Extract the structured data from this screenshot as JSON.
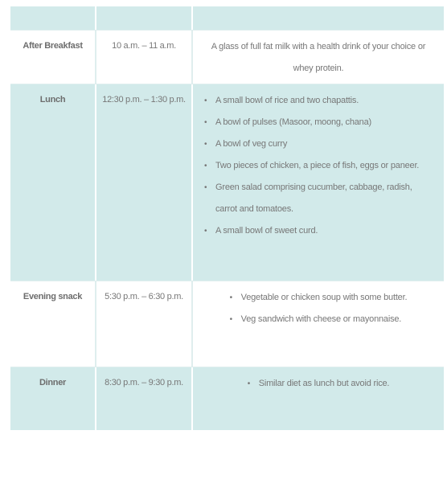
{
  "rows": [
    {
      "meal": "",
      "time": "",
      "items": []
    },
    {
      "meal": "After Breakfast",
      "time": "10 a.m. – 11 a.m.",
      "text": "A glass of full fat milk with a health drink of your choice or whey protein."
    },
    {
      "meal": "Lunch",
      "time": "12:30 p.m. – 1:30 p.m.",
      "items": [
        "A small bowl of rice and two chapattis.",
        "A bowl of pulses (Masoor, moong, chana)",
        "A bowl of veg curry",
        "Two pieces of chicken, a piece of fish, eggs or paneer.",
        "Green salad comprising cucumber, cabbage, radish, carrot and tomatoes.",
        "A small bowl of sweet curd."
      ]
    },
    {
      "meal": "Evening snack",
      "time": "5:30 p.m. – 6:30 p.m.",
      "items": [
        "Vegetable or chicken soup with some butter.",
        "Veg sandwich with cheese or mayonnaise."
      ]
    },
    {
      "meal": "Dinner",
      "time": "8:30 p.m. – 9:30 p.m.",
      "items": [
        "Similar diet as lunch but avoid rice."
      ]
    }
  ]
}
